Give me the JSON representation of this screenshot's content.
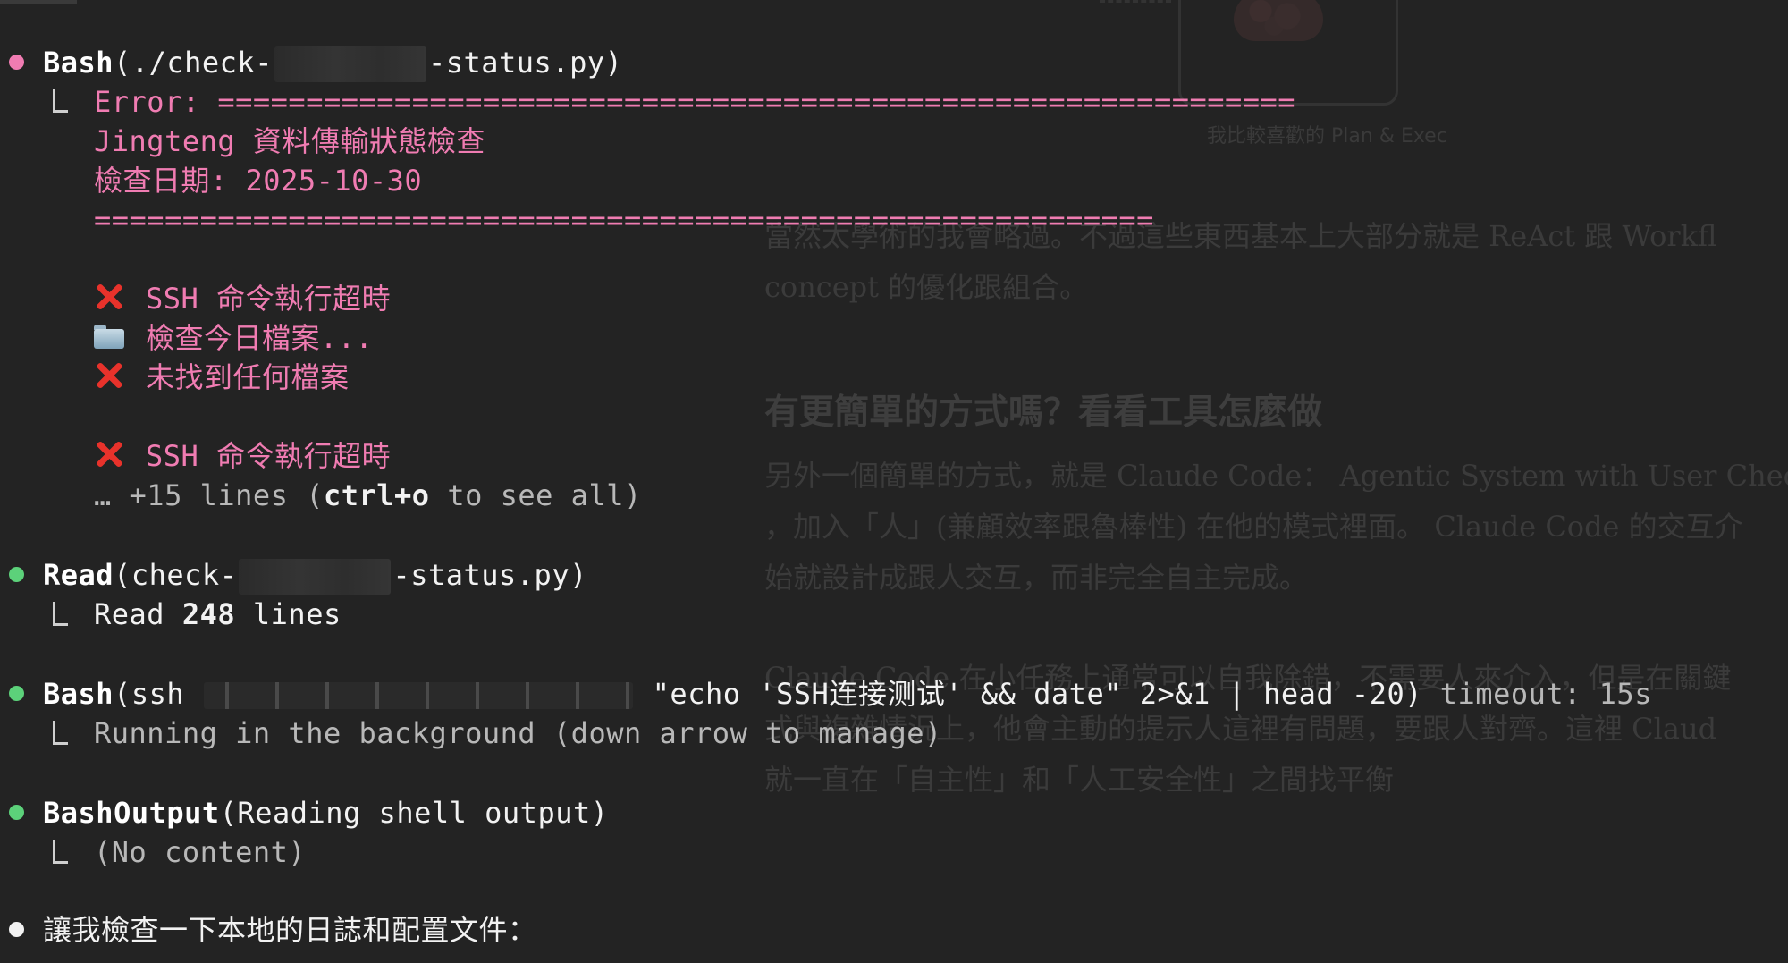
{
  "background_doc": {
    "figure_caption": "我比較喜歡的 Plan & Exec",
    "para1": [
      "當然太學術的我會略過。不過這些東西基本上大部分就是 ReAct 跟 Workfl",
      "concept 的優化跟組合。"
    ],
    "heading": "有更簡單的方式嗎？看看工具怎麼做",
    "para2": [
      "另外一個簡單的方式，就是 Claude Code： Agentic System with User Chec",
      "，加入「人」(兼顧效率跟魯棒性) 在他的模式裡面。 Claude Code 的交互介",
      "始就設計成跟人交互，而非完全自主完成。"
    ],
    "para3": [
      "Claude Code 在小任務上通常可以自我除錯，不需要人來介入，但是在關鍵",
      "式與複雜情況上，他會主動的提示人這裡有問題，要跟人對齊。這裡 Claud",
      "就一直在「自主性」和「人工安全性」之間找平衡"
    ]
  },
  "terminal": {
    "block1": {
      "tool": "Bash",
      "arg_prefix": "(./check-",
      "arg_suffix": "-status.py)",
      "error_label": "Error: ",
      "separator1": "=============================================================",
      "title": "Jingteng 資料傳輸狀態檢查",
      "date_line": "檢查日期: 2025-10-30",
      "separator2": "============================================================",
      "msg1": "SSH 命令執行超時",
      "msg2": "檢查今日檔案...",
      "msg3": "未找到任何檔案",
      "msg4": "SSH 命令執行超時",
      "more_prefix": "… +15 lines (",
      "more_key": "ctrl+o",
      "more_suffix": " to see all)"
    },
    "block2": {
      "tool": "Read",
      "arg_prefix": "(check-",
      "arg_suffix": "-status.py)",
      "result_prefix": "Read ",
      "result_count": "248",
      "result_suffix": " lines"
    },
    "block3": {
      "tool": "Bash",
      "arg_prefix": "(ssh ",
      "arg_suffix": " \"echo 'SSH连接测试' && date\" 2>&1 | head -20) ",
      "timeout": "timeout: 15s",
      "result": "Running in the background (down arrow to manage)"
    },
    "block4": {
      "tool": "BashOutput",
      "arg": "(Reading shell output)",
      "result": "(No content)"
    },
    "block5": {
      "text": "讓我檢查一下本地的日誌和配置文件："
    },
    "colors": {
      "error_pink": "#f07cb2",
      "success_green": "#5cd17a",
      "error_x_red": "#e8322b",
      "background": "#232323"
    }
  }
}
